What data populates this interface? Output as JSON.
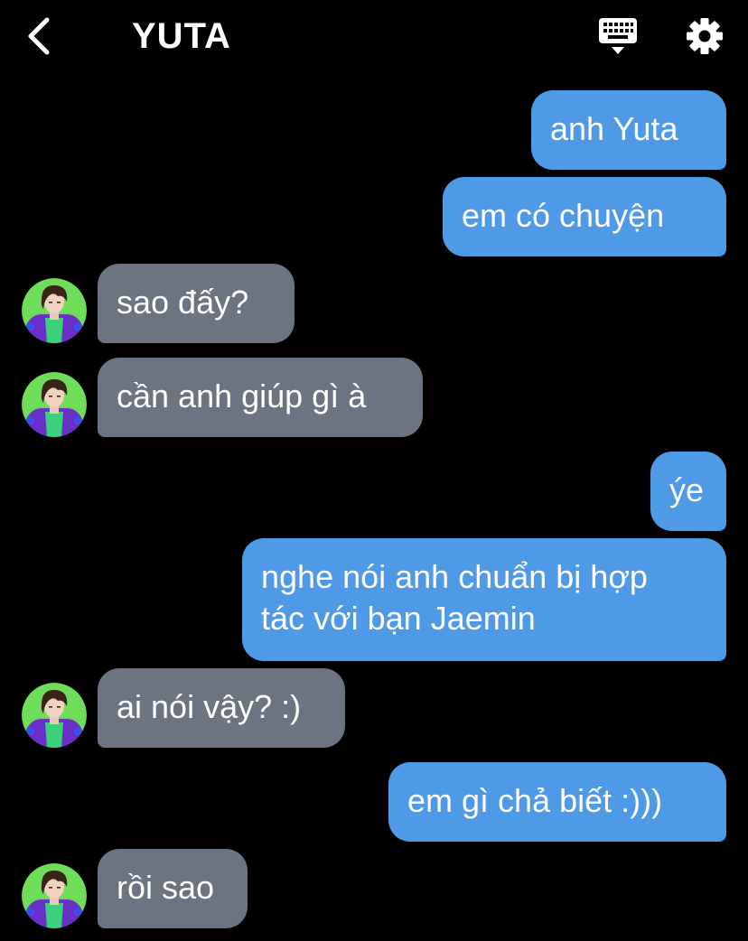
{
  "header": {
    "title": "YUTA",
    "back_icon": "chevron-left-icon",
    "keyboard_icon": "keyboard-icon",
    "settings_icon": "gear-icon"
  },
  "colors": {
    "background": "#000000",
    "outgoing_bubble": "#4e9ae6",
    "incoming_bubble": "#6b7480",
    "text": "#ffffff"
  },
  "messages": [
    {
      "side": "out",
      "text": "anh Yuta"
    },
    {
      "side": "out",
      "text": "em có chuyện"
    },
    {
      "side": "in",
      "text": "sao đấy?"
    },
    {
      "side": "in",
      "text": "cần anh giúp gì à"
    },
    {
      "side": "out",
      "text": "ýe"
    },
    {
      "side": "out",
      "lines": [
        "nghe nói anh chuẩn bị hợp",
        "tác với bạn Jaemin"
      ]
    },
    {
      "side": "in",
      "text": "ai nói vậy? :)"
    },
    {
      "side": "out",
      "text": "em gì chả biết :)))"
    },
    {
      "side": "in",
      "text": "rồi sao"
    }
  ]
}
